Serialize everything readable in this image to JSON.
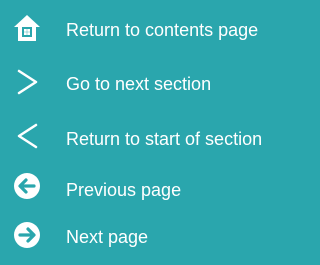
{
  "colors": {
    "background": "#2aa6ad",
    "foreground": "#ffffff"
  },
  "navigation": {
    "items": [
      {
        "label": "Return to contents page",
        "icon": "home-icon"
      },
      {
        "label": "Go to next section",
        "icon": "chevron-right-icon"
      },
      {
        "label": "Return to start of section",
        "icon": "chevron-left-icon"
      },
      {
        "label": "Previous page",
        "icon": "arrow-left-circle-icon"
      },
      {
        "label": "Next page",
        "icon": "arrow-right-circle-icon"
      }
    ]
  }
}
